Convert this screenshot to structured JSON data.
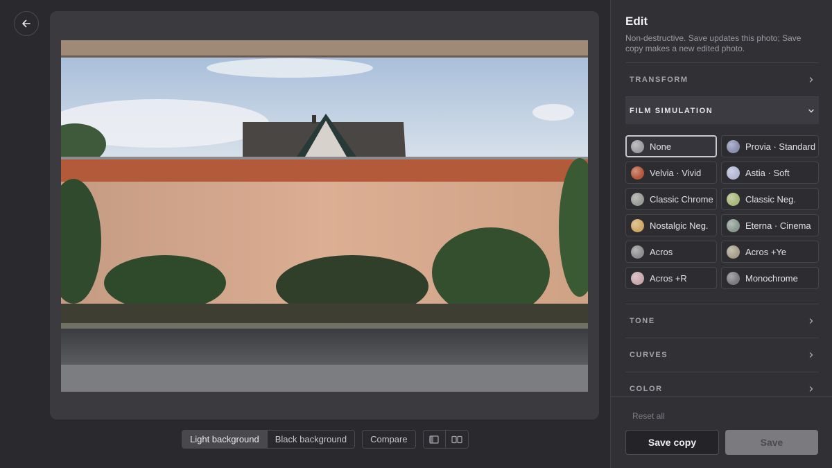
{
  "toolbar": {
    "light_bg": "Light background",
    "black_bg": "Black background",
    "compare": "Compare"
  },
  "panel": {
    "title": "Edit",
    "subtitle": "Non-destructive. Save updates this photo; Save copy makes a new edited photo.",
    "sections": {
      "transform": "TRANSFORM",
      "film": "FILM SIMULATION",
      "tone": "TONE",
      "curves": "CURVES",
      "color": "COLOR"
    },
    "sims": [
      {
        "label": "None",
        "color": "#9e9ea2"
      },
      {
        "label": "Provia · Standard",
        "color": "#8a8fb0"
      },
      {
        "label": "Velvia · Vivid",
        "color": "#b5583a"
      },
      {
        "label": "Astia · Soft",
        "color": "#b3b8d4"
      },
      {
        "label": "Classic Chrome",
        "color": "#9a9c98"
      },
      {
        "label": "Classic Neg.",
        "color": "#a9b87a"
      },
      {
        "label": "Nostalgic Neg.",
        "color": "#d1a865"
      },
      {
        "label": "Eterna · Cinema",
        "color": "#8a9a90"
      },
      {
        "label": "Acros",
        "color": "#8e8e90"
      },
      {
        "label": "Acros +Ye",
        "color": "#a7a08a"
      },
      {
        "label": "Acros +R",
        "color": "#c9a8ad"
      },
      {
        "label": "Monochrome",
        "color": "#7c7c80"
      }
    ],
    "reset": "Reset all",
    "save_copy": "Save copy",
    "save": "Save"
  }
}
